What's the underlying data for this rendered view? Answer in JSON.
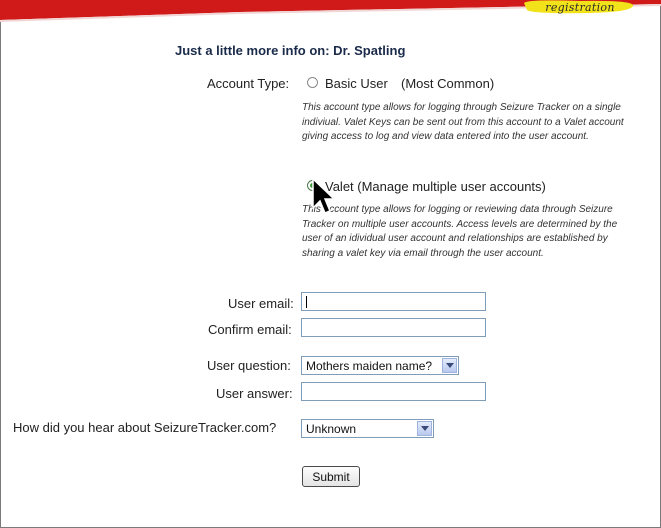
{
  "header": {
    "badge_text": "registration",
    "banner_color": "#d01a1a",
    "badge_color": "#f2e21a"
  },
  "form": {
    "title": "Just a little more info on: Dr. Spatling",
    "account_type_label": "Account Type:",
    "options": [
      {
        "label": "Basic User",
        "note": "(Most Common)",
        "selected": false,
        "description": "This account type allows for logging through Seizure Tracker on a single indiviual. Valet Keys can be sent out from this account to a Valet account giving access to log and view data entered into the user account."
      },
      {
        "label": "Valet (Manage multiple user accounts)",
        "selected": true,
        "description": "This account type allows for logging or reviewing data through Seizure Tracker on multiple user accounts. Access levels are determined by the user of an idividual user account and relationships are established by sharing a valet key via email through the user account."
      }
    ],
    "user_email_label": "User email:",
    "user_email_value": "",
    "confirm_email_label": "Confirm email:",
    "confirm_email_value": "",
    "user_question_label": "User question:",
    "user_question_value": "Mothers maiden name?",
    "user_answer_label": "User answer:",
    "user_answer_value": "",
    "referral_label": "How did you hear about SeizureTracker.com?",
    "referral_value": "Unknown",
    "submit_label": "Submit"
  }
}
